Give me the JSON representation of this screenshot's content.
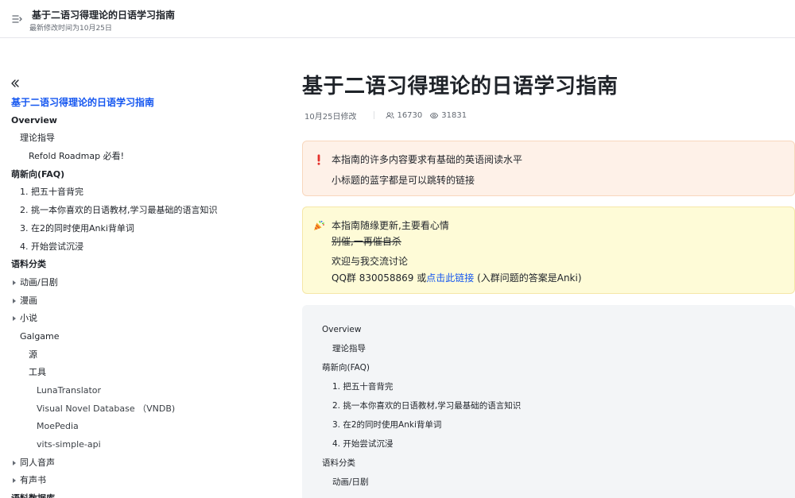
{
  "header": {
    "title": "基于二语习得理论的日语学习指南",
    "modified": "最新修改时间为10月25日"
  },
  "sidebar": {
    "items": [
      {
        "label": "基于二语习得理论的日语学习指南",
        "indent": 14,
        "style": "root",
        "arrow": false
      },
      {
        "label": "Overview",
        "indent": 14,
        "style": "bold",
        "arrow": false
      },
      {
        "label": "理论指导",
        "indent": 25,
        "style": "",
        "arrow": false
      },
      {
        "label": "Refold Roadmap 必看!",
        "indent": 36,
        "style": "",
        "arrow": false
      },
      {
        "label": "萌新向(FAQ)",
        "indent": 14,
        "style": "bold",
        "arrow": false
      },
      {
        "label": "1. 把五十音背完",
        "indent": 25,
        "style": "",
        "arrow": false
      },
      {
        "label": "2. 挑一本你喜欢的日语教材,学习最基础的语言知识",
        "indent": 25,
        "style": "",
        "arrow": false
      },
      {
        "label": "3. 在2的同时使用Anki背单词",
        "indent": 25,
        "style": "",
        "arrow": false
      },
      {
        "label": "4. 开始尝试沉浸",
        "indent": 25,
        "style": "",
        "arrow": false
      },
      {
        "label": "语料分类",
        "indent": 14,
        "style": "bold",
        "arrow": false
      },
      {
        "label": "动画/日剧",
        "indent": 25,
        "style": "",
        "arrow": true
      },
      {
        "label": "漫画",
        "indent": 25,
        "style": "",
        "arrow": true
      },
      {
        "label": "小说",
        "indent": 25,
        "style": "",
        "arrow": true
      },
      {
        "label": "Galgame",
        "indent": 25,
        "style": "",
        "arrow": false
      },
      {
        "label": "源",
        "indent": 36,
        "style": "",
        "arrow": false
      },
      {
        "label": "工具",
        "indent": 36,
        "style": "",
        "arrow": false
      },
      {
        "label": "LunaTranslator",
        "indent": 46,
        "style": "muted",
        "arrow": false
      },
      {
        "label": "Visual Novel Database （VNDB)",
        "indent": 46,
        "style": "muted",
        "arrow": false
      },
      {
        "label": "MoePedia",
        "indent": 46,
        "style": "muted",
        "arrow": false
      },
      {
        "label": "vits-simple-api",
        "indent": 46,
        "style": "muted",
        "arrow": false
      },
      {
        "label": "同人音声",
        "indent": 25,
        "style": "",
        "arrow": true
      },
      {
        "label": "有声书",
        "indent": 25,
        "style": "",
        "arrow": true
      },
      {
        "label": "语料数据库",
        "indent": 14,
        "style": "bold",
        "arrow": false
      }
    ]
  },
  "main": {
    "title": "基于二语习得理论的日语学习指南",
    "meta": {
      "modified": "10月25日修改",
      "readers": "16730",
      "views": "31831"
    },
    "callout_warn": {
      "icon": "exclamation-icon",
      "line1": "本指南的许多内容要求有基础的英语阅读水平",
      "line2": "小标题的蓝字都是可以跳转的链接"
    },
    "callout_party": {
      "icon": "party-popper-icon",
      "line1": "本指南随缘更新,主要看心情",
      "line2": "别催,一再催自杀",
      "line3": "欢迎与我交流讨论",
      "line4_prefix": "QQ群 830058869 或",
      "line4_link": "点击此链接",
      "line4_suffix": " (入群问题的答案是Anki)"
    },
    "toc_box": {
      "rows": [
        {
          "label": "Overview",
          "indent": 25
        },
        {
          "label": "理论指导",
          "indent": 38
        },
        {
          "label": "萌新向(FAQ)",
          "indent": 25
        },
        {
          "label": "1. 把五十音背完",
          "indent": 38
        },
        {
          "label": "2. 挑一本你喜欢的日语教材,学习最基础的语言知识",
          "indent": 38
        },
        {
          "label": "3. 在2的同时使用Anki背单词",
          "indent": 38
        },
        {
          "label": "4. 开始尝试沉浸",
          "indent": 38
        },
        {
          "label": "语料分类",
          "indent": 25
        },
        {
          "label": "动画/日剧",
          "indent": 38
        }
      ]
    }
  }
}
